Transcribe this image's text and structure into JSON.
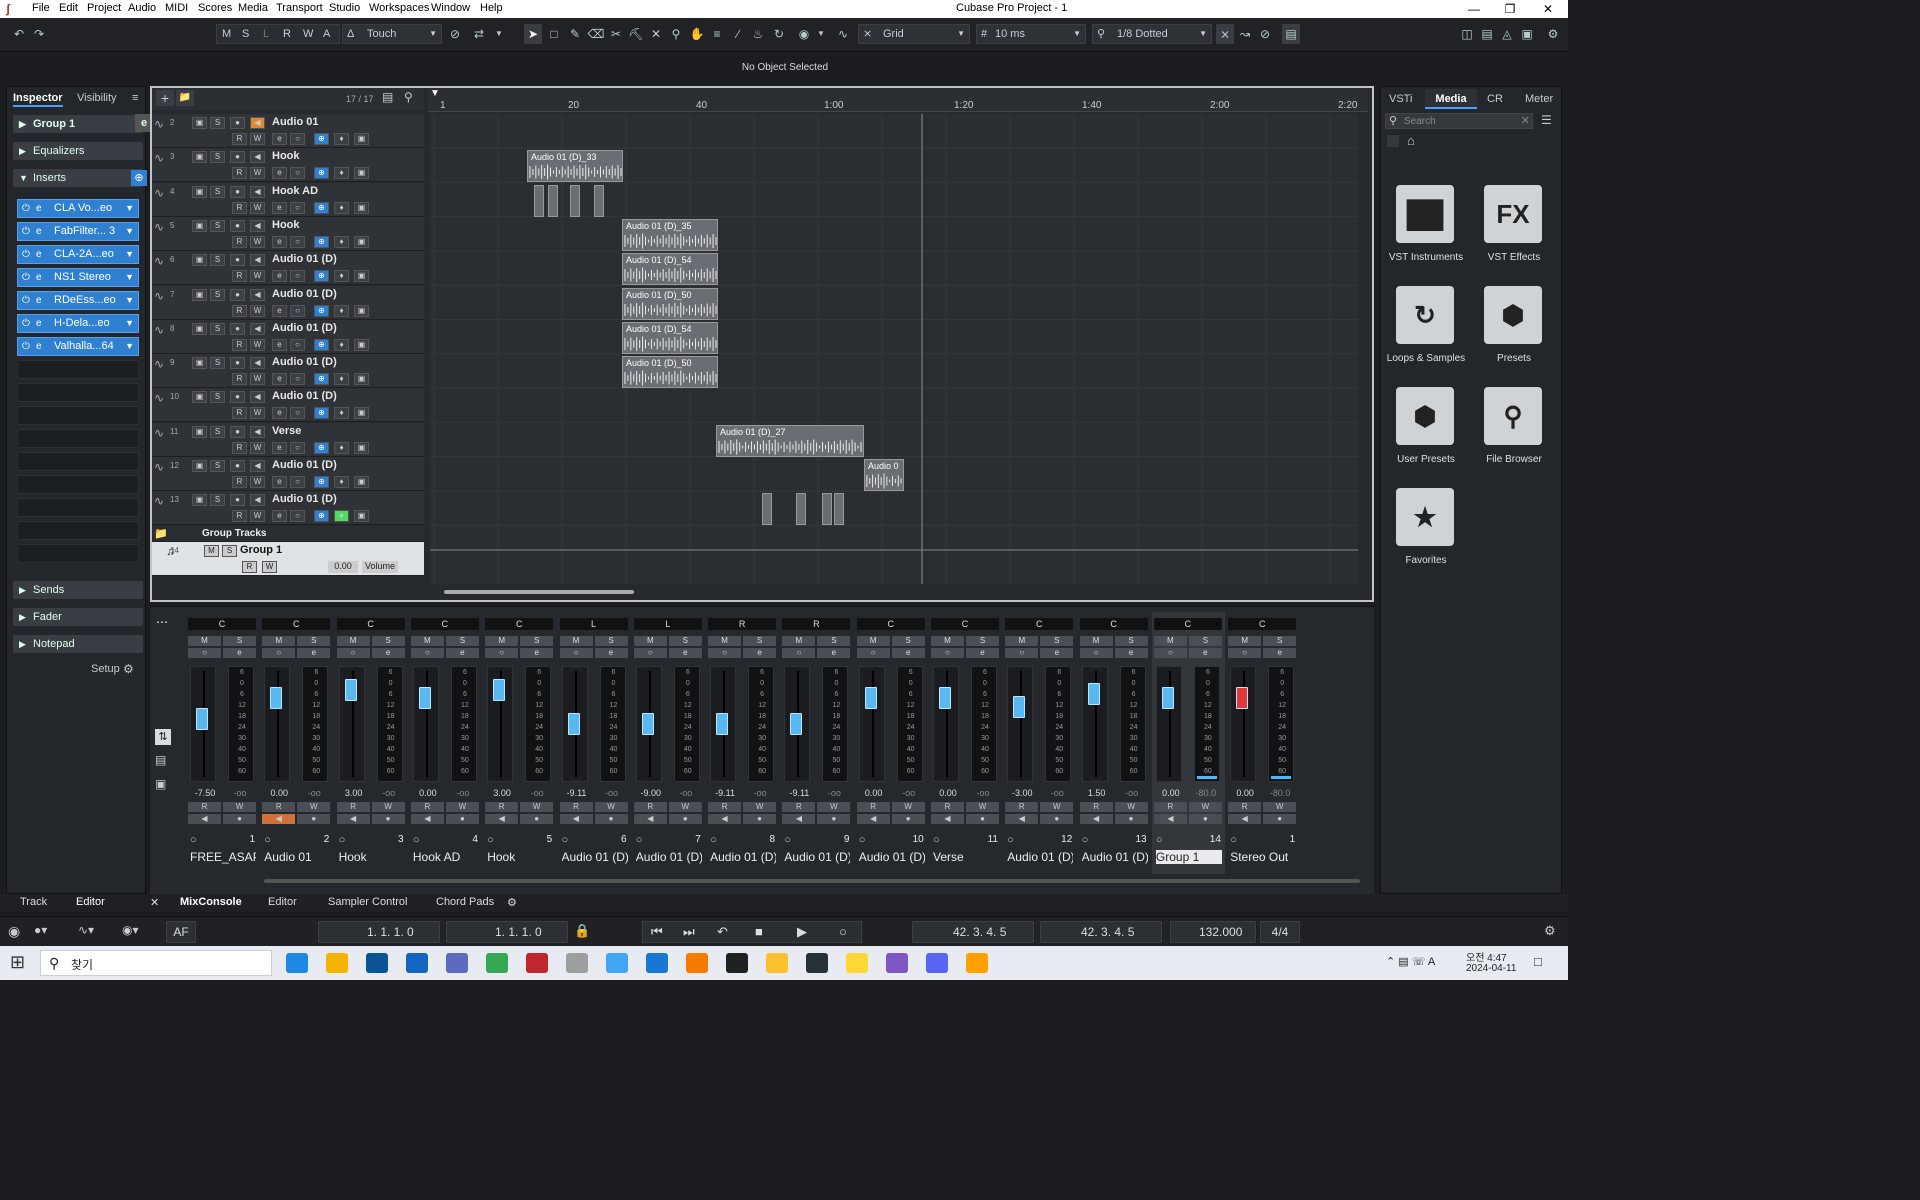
{
  "titlebar": {
    "menus": [
      "File",
      "Edit",
      "Project",
      "Audio",
      "MIDI",
      "Scores",
      "Media",
      "Transport",
      "Studio",
      "Workspaces",
      "Window",
      "Help"
    ],
    "title": "Cubase Pro Project - 1"
  },
  "toolbar": {
    "msr": [
      "M",
      "S",
      "L",
      "R",
      "W",
      "A"
    ],
    "automation_mode": "Touch",
    "snap_type": "Grid",
    "nudge": "10 ms",
    "quantize": "1/8 Dotted"
  },
  "status": {
    "selection": "No Object Selected"
  },
  "inspector": {
    "tabs": [
      "Inspector",
      "Visibility"
    ],
    "track_name": "Group 1",
    "sections": [
      "Equalizers",
      "Inserts",
      "Sends",
      "Fader",
      "Notepad"
    ],
    "inserts": [
      "CLA Vo...eo",
      "FabFilter... 3",
      "CLA-2A...eo",
      "NS1 Stereo",
      "RDeEss...eo",
      "H-Dela...eo",
      "Valhalla...64"
    ],
    "setup": "Setup"
  },
  "project": {
    "track_count": "17 / 17",
    "ruler": [
      "1",
      "20",
      "40",
      "1:00",
      "1:20",
      "1:40",
      "2:00",
      "2:20"
    ],
    "tracks": [
      {
        "num": "2",
        "name": "Audio 01"
      },
      {
        "num": "3",
        "name": "Hook"
      },
      {
        "num": "4",
        "name": "Hook AD"
      },
      {
        "num": "5",
        "name": "Hook"
      },
      {
        "num": "6",
        "name": "Audio 01 (D)"
      },
      {
        "num": "7",
        "name": "Audio 01 (D)"
      },
      {
        "num": "8",
        "name": "Audio 01 (D)"
      },
      {
        "num": "9",
        "name": "Audio 01 (D)"
      },
      {
        "num": "10",
        "name": "Audio 01 (D)"
      },
      {
        "num": "11",
        "name": "Verse"
      },
      {
        "num": "12",
        "name": "Audio 01 (D)"
      },
      {
        "num": "13",
        "name": "Audio 01 (D)"
      }
    ],
    "group_folder": "Group Tracks",
    "group_track": {
      "num": "14",
      "name": "Group 1",
      "volume": "0.00",
      "volume_label": "Volume"
    },
    "clips": [
      "Audio 01 (D)_33",
      "Audio 01 (D)_35",
      "Audio 01 (D)_54",
      "Audio 01 (D)_50",
      "Audio 01 (D)_54",
      "Audio 01 (D)_50",
      "Audio 01 (D)_27",
      "Audio 0"
    ]
  },
  "media": {
    "tabs": [
      "VSTi",
      "Media",
      "CR",
      "Meter"
    ],
    "search_placeholder": "Search",
    "tiles": [
      "VST Instruments",
      "VST Effects",
      "Loops & Samples",
      "Presets",
      "User Presets",
      "File Browser",
      "Favorites"
    ]
  },
  "mixer": {
    "channels": [
      {
        "pan": "C",
        "vol": "-7.50",
        "peak": "-oo",
        "num": "1",
        "name": "FREE_ASAP_F",
        "fader": 0.55
      },
      {
        "pan": "C",
        "vol": "0.00",
        "peak": "-oo",
        "num": "2",
        "name": "Audio 01",
        "fader": 0.78
      },
      {
        "pan": "C",
        "vol": "3.00",
        "peak": "-oo",
        "num": "3",
        "name": "Hook",
        "fader": 0.86
      },
      {
        "pan": "C",
        "vol": "0.00",
        "peak": "-oo",
        "num": "4",
        "name": "Hook AD",
        "fader": 0.78
      },
      {
        "pan": "C",
        "vol": "3.00",
        "peak": "-oo",
        "num": "5",
        "name": "Hook",
        "fader": 0.86
      },
      {
        "pan": "L",
        "vol": "-9.11",
        "peak": "-oo",
        "num": "6",
        "name": "Audio 01 (D)",
        "fader": 0.5
      },
      {
        "pan": "L",
        "vol": "-9.00",
        "peak": "-oo",
        "num": "7",
        "name": "Audio 01 (D)",
        "fader": 0.5
      },
      {
        "pan": "R",
        "vol": "-9.11",
        "peak": "-oo",
        "num": "8",
        "name": "Audio 01 (D)",
        "fader": 0.5
      },
      {
        "pan": "R",
        "vol": "-9.11",
        "peak": "-oo",
        "num": "9",
        "name": "Audio 01 (D)",
        "fader": 0.5
      },
      {
        "pan": "C",
        "vol": "0.00",
        "peak": "-oo",
        "num": "10",
        "name": "Audio 01 (D)",
        "fader": 0.78
      },
      {
        "pan": "C",
        "vol": "0.00",
        "peak": "-oo",
        "num": "11",
        "name": "Verse",
        "fader": 0.78
      },
      {
        "pan": "C",
        "vol": "-3.00",
        "peak": "-oo",
        "num": "12",
        "name": "Audio 01 (D)",
        "fader": 0.68
      },
      {
        "pan": "C",
        "vol": "1.50",
        "peak": "-oo",
        "num": "13",
        "name": "Audio 01 (D)",
        "fader": 0.82
      },
      {
        "pan": "C",
        "vol": "0.00",
        "peak": "-80.0",
        "num": "14",
        "name": "Group 1",
        "fader": 0.78
      },
      {
        "pan": "C",
        "vol": "0.00",
        "peak": "-80.0",
        "num": "1",
        "name": "Stereo Out",
        "fader": 0.78
      }
    ],
    "scale": [
      "6",
      "0",
      "6",
      "12",
      "18",
      "24",
      "30",
      "40",
      "50",
      "60"
    ]
  },
  "bottomtabs": {
    "left": [
      "Track",
      "Editor"
    ],
    "right": [
      "MixConsole",
      "Editor",
      "Sampler Control",
      "Chord Pads"
    ]
  },
  "transport": {
    "left_locator": "1. 1. 1.   0",
    "right_locator": "1. 1. 1.   0",
    "position": "42. 3. 4.   5",
    "position2": "42. 3. 4.   5",
    "tempo": "132.000",
    "signature": "4/4",
    "af": "AF"
  },
  "taskbar": {
    "search": "찾기",
    "time": "오전 4:47",
    "date": "2024-04-11"
  }
}
